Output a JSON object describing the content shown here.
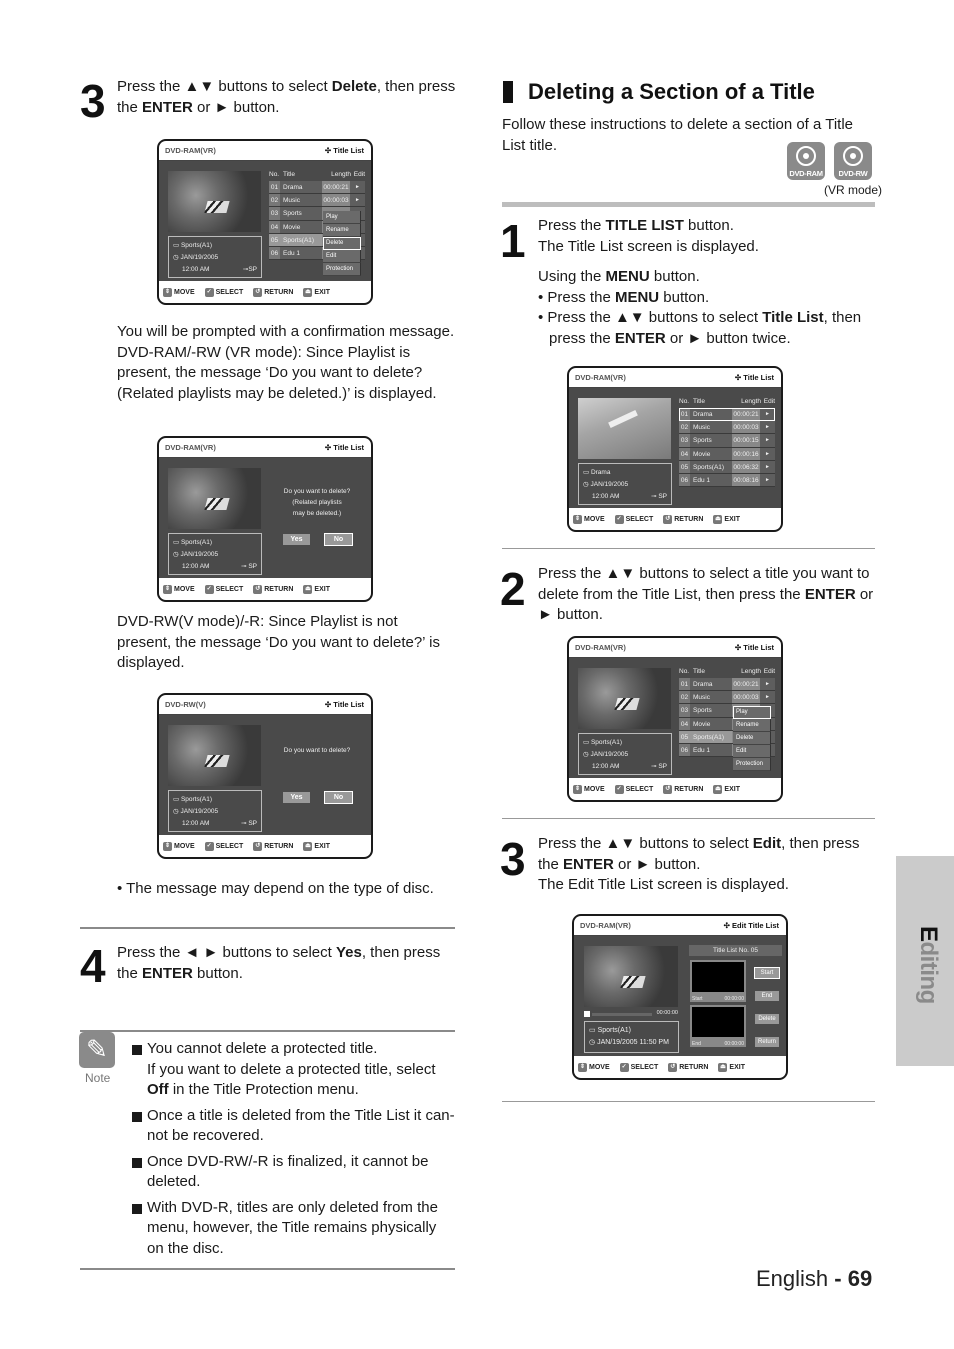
{
  "left": {
    "step3": {
      "num": "3",
      "l1_a": "Press the ▲▼ buttons to select ",
      "l1_b": "Delete",
      "l1_c": ", then press",
      "l2_a": "the ",
      "l2_b": "ENTER",
      "l2_c": " or ► button."
    },
    "confirm_text": [
      "You will be prompted with a confirmation message.",
      "DVD-RAM/-RW (VR mode):  Since Playlist is",
      "present, the message ‘Do you want to delete?",
      "(Related playlists may be deleted.)’ is displayed."
    ],
    "vmode_text": [
      "DVD-RW(V mode)/-R:  Since Playlist is not",
      "present, the message ‘Do you want to delete?’ is",
      "displayed."
    ],
    "bullet_msg": "•  The message may depend on the type of disc.",
    "step4": {
      "num": "4",
      "l1_a": "Press the ◄ ► buttons to select ",
      "l1_b": "Yes",
      "l1_c": ", then press",
      "l2_a": "the ",
      "l2_b": "ENTER",
      "l2_c": " button."
    },
    "note": {
      "label": "Note",
      "items": [
        {
          "a": "You cannot delete a protected title.",
          "b": "If you want to delete a protected title, select",
          "c_bold": "Off",
          "c": " in the Title Protection menu."
        },
        {
          "a": "Once a title is deleted from the Title List it can-",
          "b": "not be recovered."
        },
        {
          "a": "Once DVD-RW/-R is finalized, it cannot be",
          "b": "deleted."
        },
        {
          "a": "With DVD-R, titles are only deleted from the",
          "b": "menu, however, the Title remains physically",
          "c": "on the disc."
        }
      ]
    }
  },
  "right": {
    "section_title": "Deleting a Section of a Title",
    "intro": [
      "Follow these instructions to delete a section of a Title",
      "List title."
    ],
    "disc_icons": [
      {
        "label": "DVD-RAM"
      },
      {
        "label": "DVD-RW"
      }
    ],
    "vr_mode": "(VR mode)",
    "step1": {
      "num": "1",
      "l1_a": "Press the ",
      "l1_b": "TITLE LIST",
      "l1_c": " button.",
      "l2": "The Title List screen is displayed.",
      "l3_a": "Using the ",
      "l3_b": "MENU",
      "l3_c": " button.",
      "l4_a": "• Press the ",
      "l4_b": "MENU",
      "l4_c": " button.",
      "l5_a": "• Press the ▲▼ buttons to select ",
      "l5_b": "Title List",
      "l5_c": ", then",
      "l6_a": "press the ",
      "l6_b": "ENTER",
      "l6_c": " or ► button twice."
    },
    "step2": {
      "num": "2",
      "l1": "Press the ▲▼ buttons to select a title you want to",
      "l2_a": "delete from the Title List, then press the ",
      "l2_b": "ENTER",
      "l2_c": " or",
      "l3": "► button."
    },
    "step3": {
      "num": "3",
      "l1_a": "Press the ▲▼ buttons to select ",
      "l1_b": "Edit",
      "l1_c": ", then press",
      "l2_a": "the ",
      "l2_b": "ENTER",
      "l2_c": " or ► button.",
      "l3": "The Edit Title List screen is displayed."
    }
  },
  "screens": {
    "footer": {
      "move": "MOVE",
      "select": "SELECT",
      "return": "RETURN",
      "exit": "EXIT"
    },
    "title_list_label": "Title List",
    "edit_title_list_label": "Edit Title List",
    "col_no": "No.",
    "col_title": "Title",
    "col_length": "Length",
    "col_edit": "Edit",
    "rows": [
      {
        "no": "01",
        "title": "Drama",
        "length": "00:00:21"
      },
      {
        "no": "02",
        "title": "Music",
        "length": "00:00:03"
      },
      {
        "no": "03",
        "title": "Sports",
        "length": "00:00:15"
      },
      {
        "no": "04",
        "title": "Movie",
        "length": "00:00:16"
      },
      {
        "no": "05",
        "title": "Sports(A1)",
        "length": "00:06:32"
      },
      {
        "no": "06",
        "title": "Edu 1",
        "length": "00:08:16"
      }
    ],
    "popup": [
      "Play",
      "Rename",
      "Delete",
      "Edit",
      "Protection"
    ],
    "info_sports": {
      "name": "Sports(A1)",
      "date": "JAN/19/2005",
      "time": "12:00 AM",
      "mode": "SP"
    },
    "info_drama": {
      "name": "Drama",
      "date": "JAN/19/2005",
      "time": "12:00 AM",
      "mode": "SP"
    },
    "s1": {
      "disc": "DVD-RAM(VR)"
    },
    "s2": {
      "disc": "DVD-RAM(VR)",
      "msg": [
        "Do you want to delete?",
        "(Related playlists",
        "may be deleted.)"
      ],
      "yes": "Yes",
      "no": "No"
    },
    "s3": {
      "disc": "DVD-RW(V)",
      "msg": "Do you want to delete?",
      "yes": "Yes",
      "no": "No"
    },
    "s4": {
      "disc": "DVD-RAM(VR)"
    },
    "s5": {
      "disc": "DVD-RAM(VR)"
    },
    "s6": {
      "disc": "DVD-RAM(VR)",
      "title_no": "Title List No. 05",
      "progress_time": "00:00:00",
      "info_name": "Sports(A1)",
      "info_datetime": "JAN/19/2005 11:50 PM",
      "start_lbl": "Start",
      "start_time": "00:00:00",
      "end_lbl": "End",
      "end_time": "00:00:00",
      "buttons": [
        "Start",
        "End",
        "Delete",
        "Return"
      ]
    }
  },
  "side_tab": "Editing",
  "page_footer": {
    "lang": "English",
    "sep": " - ",
    "page": "69"
  }
}
